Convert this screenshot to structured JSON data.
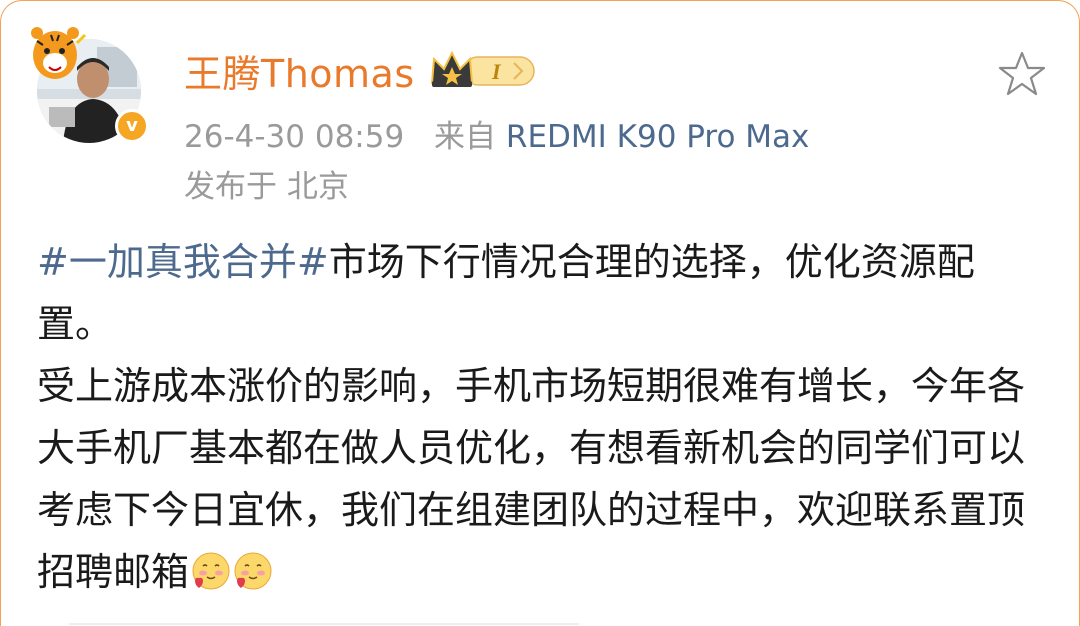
{
  "post": {
    "author": "王腾Thomas",
    "badge_level": "I",
    "date": "26-4-30 08:59",
    "source_prefix": "来自",
    "device": "REDMI K90 Pro Max",
    "location": "发布于 北京",
    "topic": "#一加真我合并#",
    "paragraph1_rest": "市场下行情况合理的选择，优化资源配置。",
    "paragraph2": "受上游成本涨价的影响，手机市场短期很难有增长，今年各大手机厂基本都在做人员优化，有想看新机会的同学们可以考虑下今日宜休，我们在组建团队的过程中，欢迎联系置顶招聘邮箱"
  },
  "icons": {
    "favorite": "star-icon",
    "verified": "verified-badge-icon",
    "membership": "crown-badge-icon",
    "emoji": "blushing-heart-emoji"
  },
  "colors": {
    "username": "#ea7a2b",
    "link": "#4d6a8e",
    "meta": "#9a9a9a",
    "text": "#1a1a1a",
    "verified": "#f5a623"
  }
}
